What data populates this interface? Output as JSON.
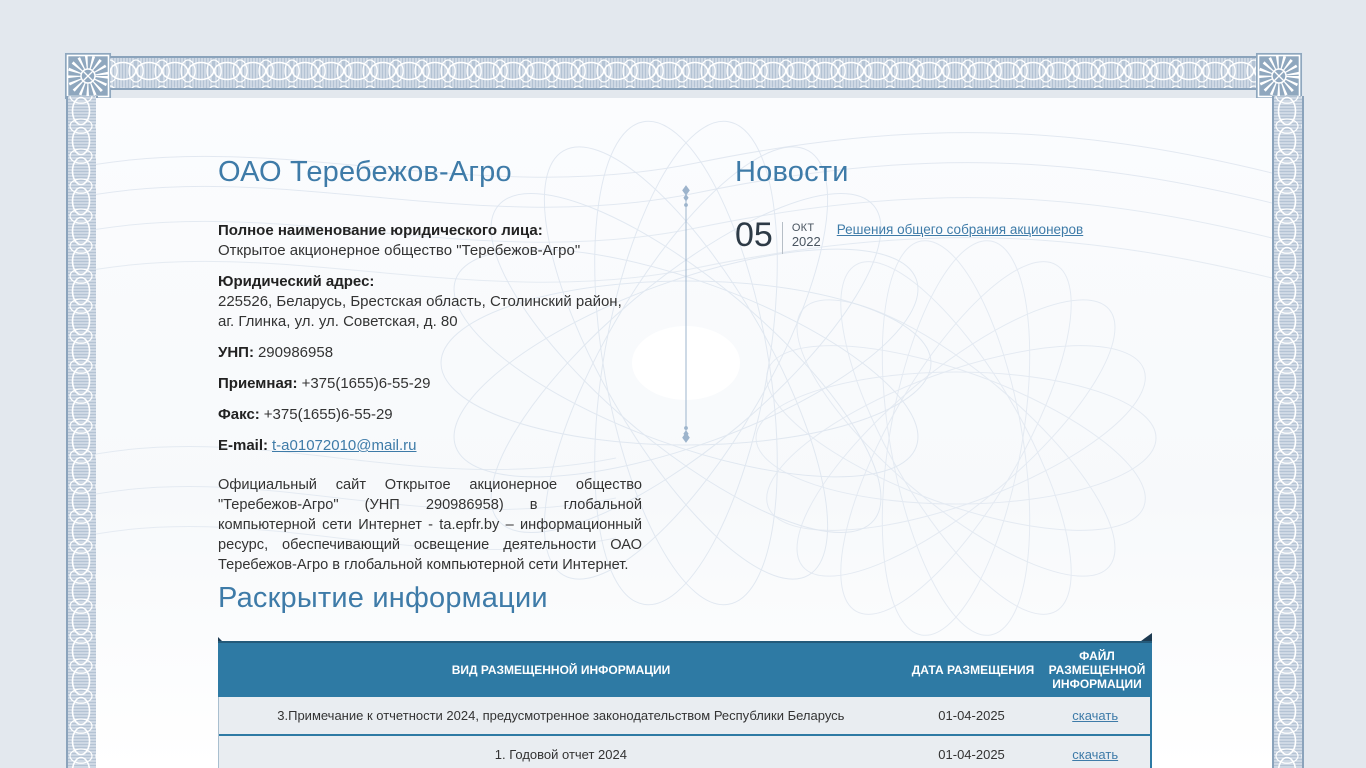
{
  "theme": {
    "accent_blue": "#2e7aa4",
    "heading_blue": "#3e7ba8",
    "frame_blue": "#a9bccf",
    "row_bg": "#e9edf1",
    "page_bg": "#e3e8ee"
  },
  "company": {
    "title": "ОАО Теребежов-Агро",
    "full_name_label": "Полное наименование юридического лица:",
    "full_name_value": "Открытое акционерное общество \"Теребежов-Агро\"",
    "address_label": "Юридический адрес:",
    "address_value": "225526, Беларусь, Брестская область, Столинский район, аг. Глинка, ул. ул. Советская, д. 80",
    "unp_label": "УНП:",
    "unp_value": "290986958",
    "reception_label": "Приемная:",
    "reception_value": "+375(1655)6-55-29",
    "fax_label": "Факс:",
    "fax_value": "+375(1655)6-55-29",
    "email_label": "E-mail:",
    "email_value": "t-a01072010@mail.ru",
    "about": "Официальный сайт Открытое акционерное общество \"Теребежов-Агро\" (УНП 290986958) в глобальной компьютерной сети Интернет - ta.epfr.by – информационный ресурс, обеспечивающий освещение деятельности ОАО Теребежов-Агро в глобальной компьютерной сети Интернет."
  },
  "news": {
    "title": "Новости",
    "items": [
      {
        "day": "05",
        "month": "окт",
        "year": "2022",
        "link_label": "Решения общего собрания акционеров"
      }
    ]
  },
  "disclosure": {
    "title": "Раскрытие информации",
    "table": {
      "headers": [
        "ВИД РАЗМЕЩЕННОЙ ИНФОРМАЦИИ",
        "ДАТА РАЗМЕЩЕНИЯ",
        "ФАЙЛ РАЗМЕЩЕННОЙ ИНФОРМАЦИИ"
      ],
      "rows": [
        {
          "name": "3.Примечание к отчетности 2024, предусмотренное законодательством Республики Беларусь",
          "date": "01-04-2025",
          "file_label": "скачать"
        },
        {
          "name": "1. Годовой отчет 2024",
          "date": "01-04-2025",
          "file_label": "скачать"
        }
      ]
    }
  }
}
